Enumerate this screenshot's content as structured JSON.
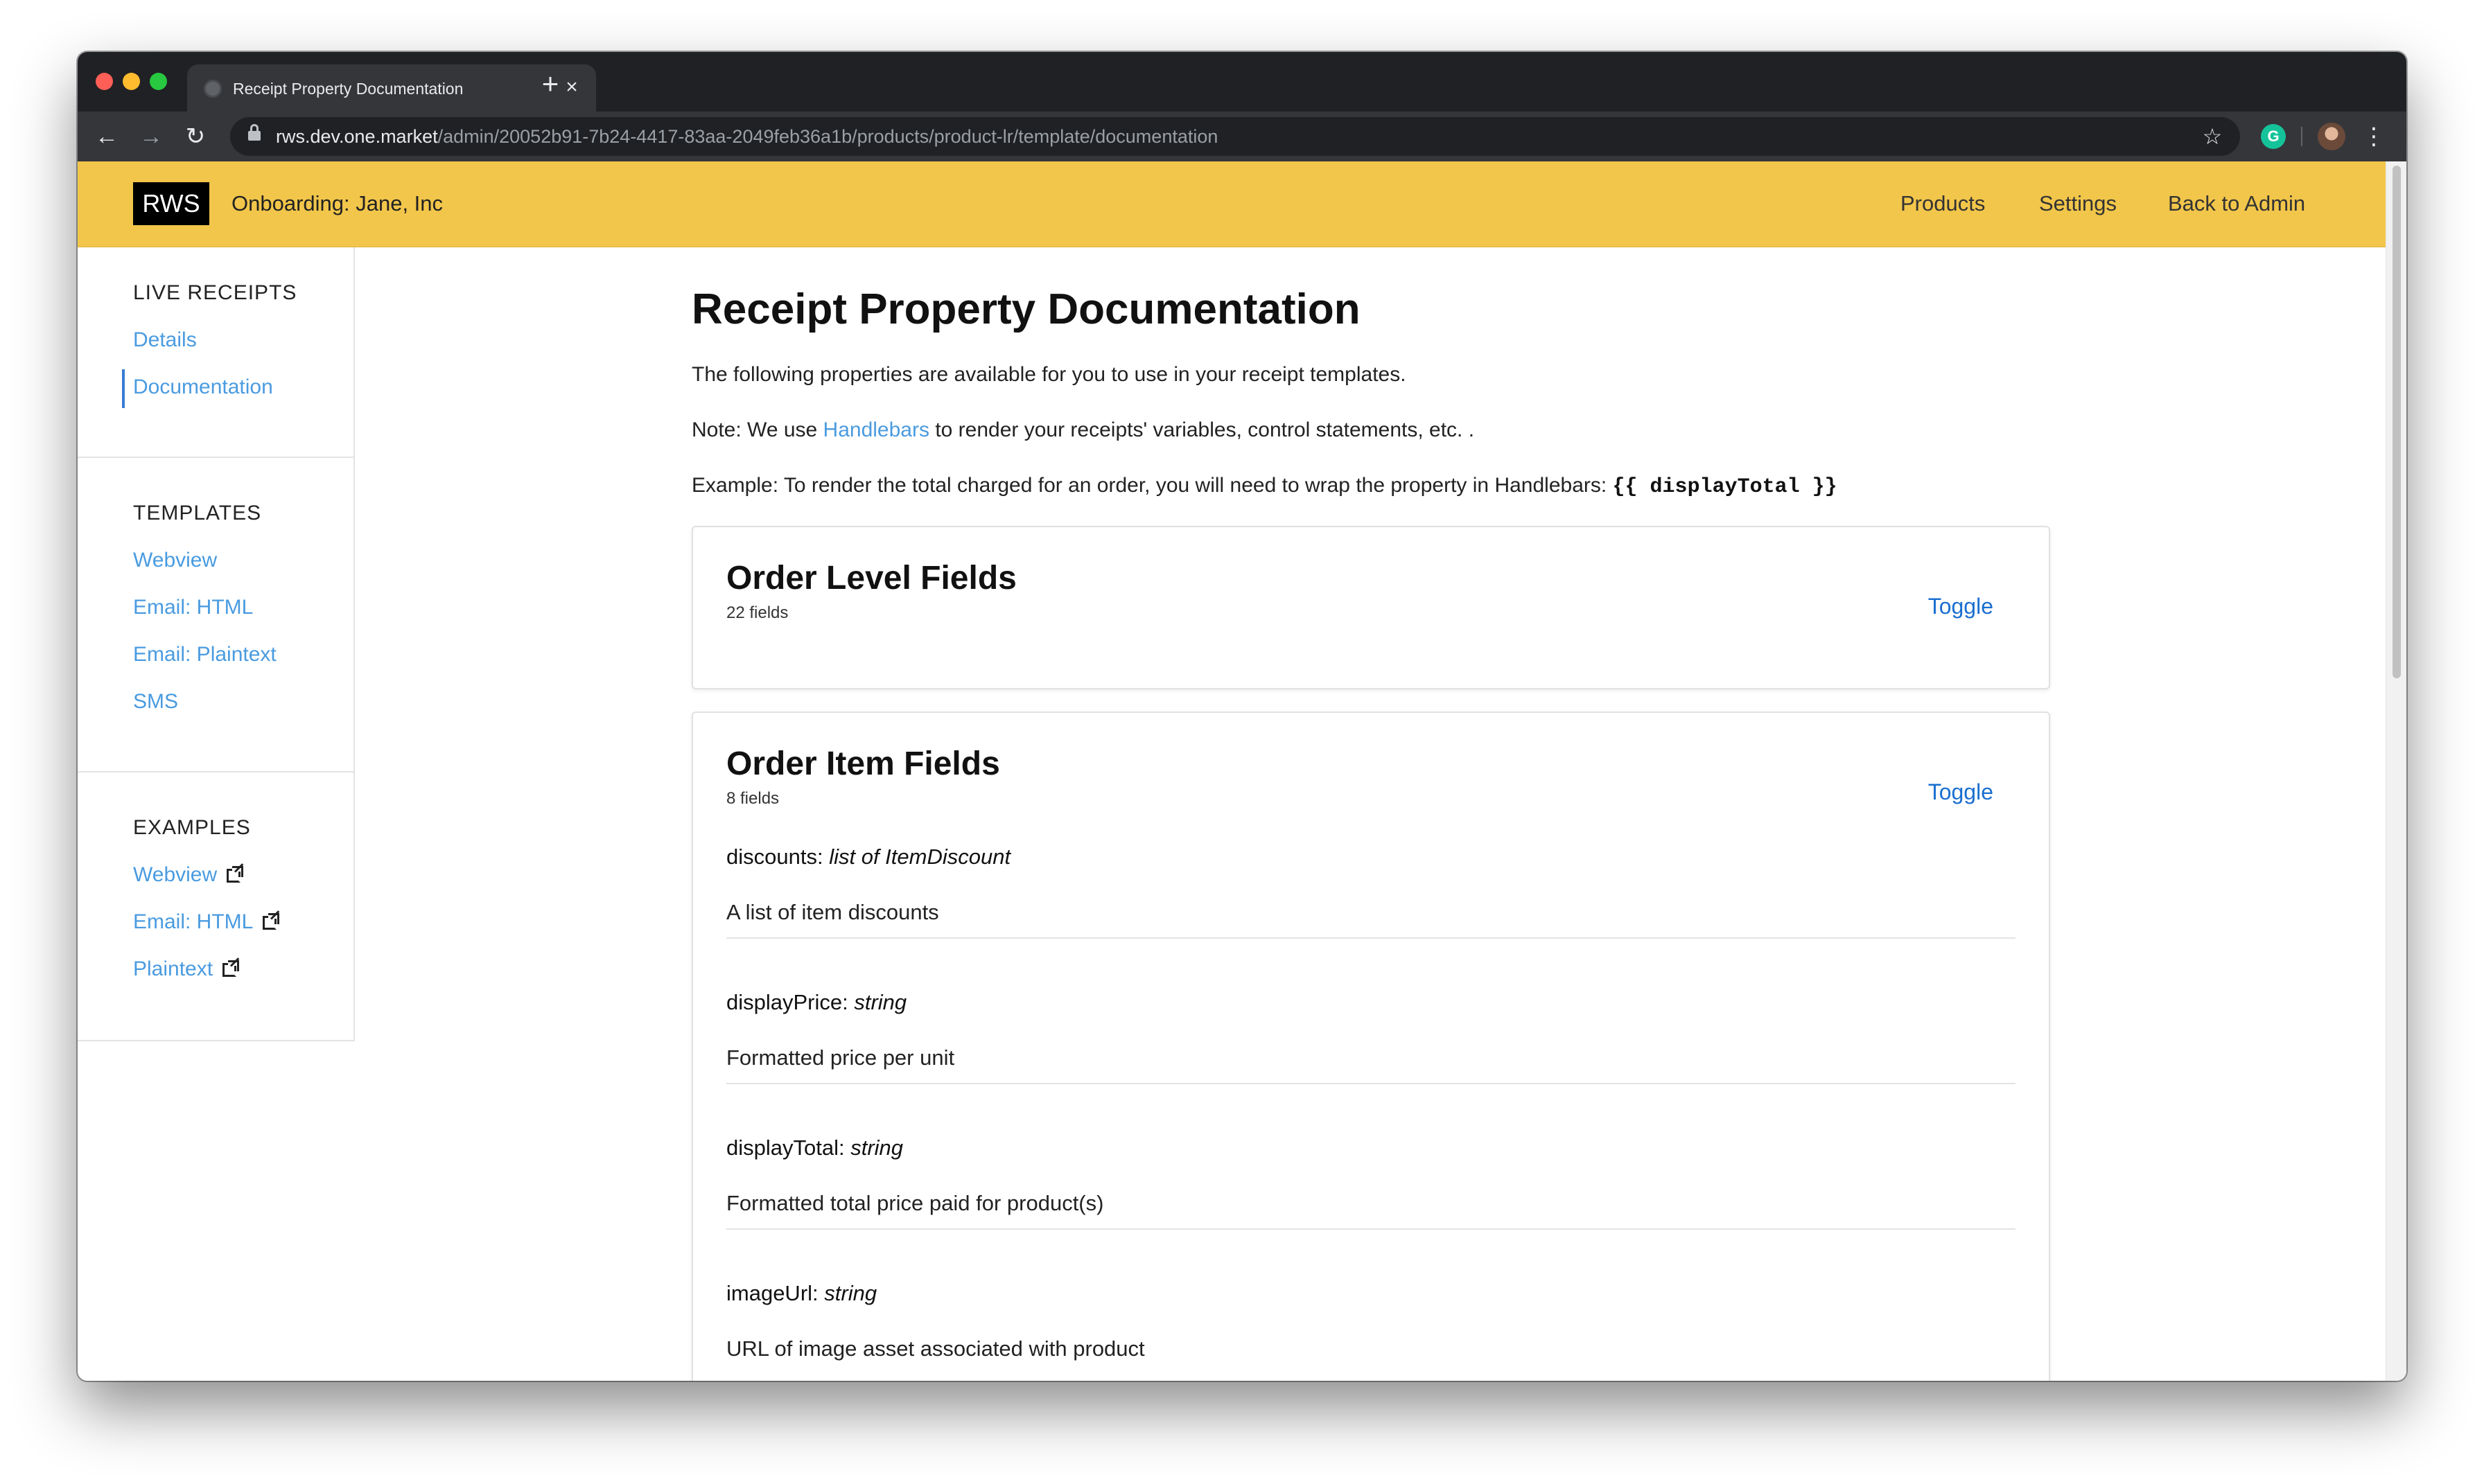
{
  "browser": {
    "tab_title": "Receipt Property Documentation",
    "tab_close": "×",
    "new_tab": "+",
    "url_host": "rws.dev.one.market",
    "url_path": "/admin/20052b91-7b24-4417-83aa-2049feb36a1b/products/product-lr/template/documentation",
    "grammarly_letter": "G"
  },
  "header": {
    "logo": "RWS",
    "org": "Onboarding: Jane, Inc",
    "nav": [
      "Products",
      "Settings",
      "Back to Admin"
    ],
    "accent_color": "#f2c64a"
  },
  "sidebar": {
    "sections": [
      {
        "heading": "LIVE RECEIPTS",
        "items": [
          "Details",
          "Documentation"
        ],
        "active": "Documentation"
      },
      {
        "heading": "TEMPLATES",
        "items": [
          "Webview",
          "Email: HTML",
          "Email: Plaintext",
          "SMS"
        ]
      },
      {
        "heading": "EXAMPLES",
        "items": [
          "Webview",
          "Email: HTML",
          "Plaintext"
        ],
        "external_icon": "external-link-icon"
      }
    ],
    "link_color": "#4a9be0"
  },
  "main": {
    "title": "Receipt Property Documentation",
    "intro": "The following properties are available for you to use in your receipt templates.",
    "note_prefix": "Note: We use ",
    "note_link": "Handlebars",
    "note_suffix": " to render your receipts' variables, control statements, etc. .",
    "example_prefix": "Example: To render the total charged for an order, you will need to wrap the property in Handlebars: ",
    "example_code": "{{ displayTotal }}",
    "cards": [
      {
        "title": "Order Level Fields",
        "count": "22 fields",
        "toggle": "Toggle",
        "fields": []
      },
      {
        "title": "Order Item Fields",
        "count": "8 fields",
        "toggle": "Toggle",
        "fields": [
          {
            "name": "discounts",
            "type": "list of ItemDiscount",
            "description": "A list of item discounts"
          },
          {
            "name": "displayPrice",
            "type": "string",
            "description": "Formatted price per unit"
          },
          {
            "name": "displayTotal",
            "type": "string",
            "description": "Formatted total price paid for product(s)"
          },
          {
            "name": "imageUrl",
            "type": "string",
            "description": "URL of image asset associated with product"
          }
        ]
      }
    ]
  }
}
